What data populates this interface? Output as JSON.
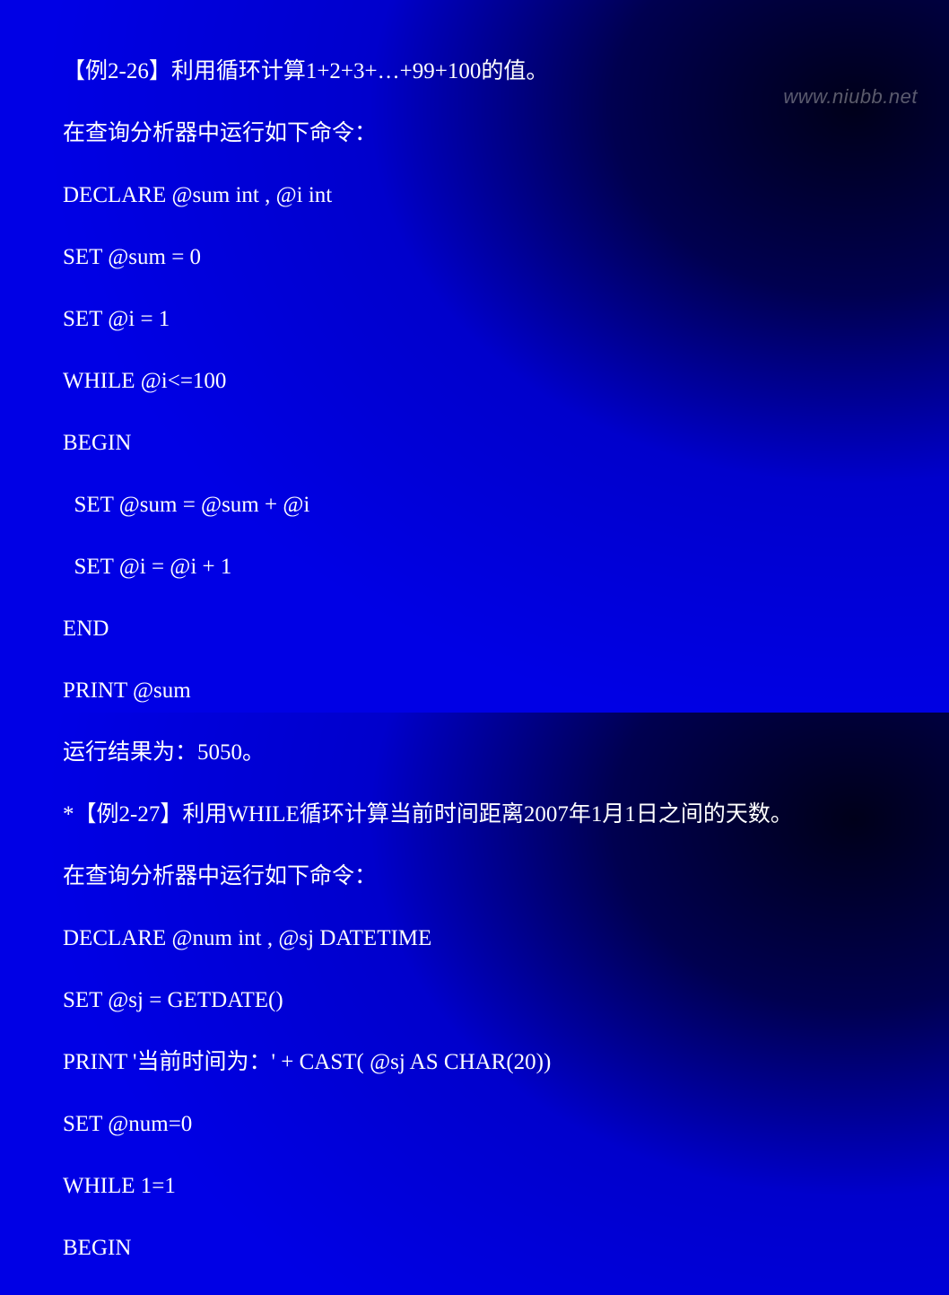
{
  "watermark": "www.niubb.net",
  "lines": {
    "l1": "【例2-26】利用循环计算1+2+3+…+99+100的值。",
    "l2": "在查询分析器中运行如下命令：",
    "l3": "DECLARE @sum int , @i int",
    "l4": "SET @sum = 0",
    "l5": "SET @i = 1",
    "l6": "WHILE @i<=100",
    "l7": "BEGIN",
    "l8": "  SET @sum = @sum + @i",
    "l9": "  SET @i = @i + 1",
    "l10": "END",
    "l11": "PRINT @sum",
    "l12": "运行结果为：5050。",
    "l13": "*【例2-27】利用WHILE循环计算当前时间距离2007年1月1日之间的天数。",
    "l14": "在查询分析器中运行如下命令：",
    "l15": "DECLARE @num int , @sj DATETIME",
    "l16": "SET @sj = GETDATE()",
    "l17": "PRINT '当前时间为：' + CAST( @sj AS CHAR(20))",
    "l18": "SET @num=0",
    "l19": "WHILE 1=1",
    "l20": "BEGIN"
  }
}
